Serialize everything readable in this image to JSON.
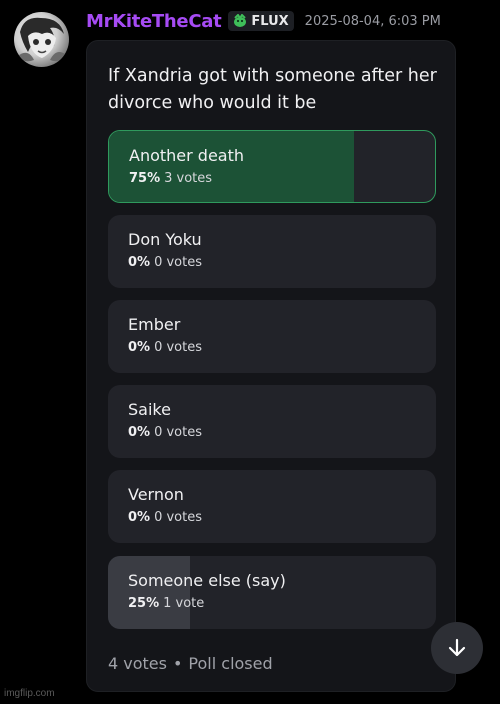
{
  "message": {
    "username": "MrKiteTheCat",
    "tag": {
      "icon": "leaf-icon",
      "label": "FLUX"
    },
    "timestamp": "2025-08-04, 6:03 PM",
    "colors": {
      "username": "#a64bf4",
      "winner_border": "#2f9a5d",
      "winner_fill": "#1c5236"
    }
  },
  "poll": {
    "question": "If Xandria got with someone after her divorce who would it be",
    "options": [
      {
        "label": "Another death",
        "percent": "75%",
        "votes": "3 votes",
        "share": 0.75,
        "winner": true
      },
      {
        "label": "Don Yoku",
        "percent": "0%",
        "votes": "0 votes",
        "share": 0,
        "winner": false
      },
      {
        "label": "Ember",
        "percent": "0%",
        "votes": "0 votes",
        "share": 0,
        "winner": false
      },
      {
        "label": "Saike",
        "percent": "0%",
        "votes": "0 votes",
        "share": 0,
        "winner": false
      },
      {
        "label": "Vernon",
        "percent": "0%",
        "votes": "0 votes",
        "share": 0,
        "winner": false
      },
      {
        "label": "Someone else (say)",
        "percent": "25%",
        "votes": "1 vote",
        "share": 0.25,
        "winner": false
      }
    ],
    "footer": {
      "total": "4 votes",
      "separator": "•",
      "status": "Poll closed"
    }
  },
  "scroll_button": {
    "icon": "arrow-down-icon"
  },
  "watermark": "imgflip.com"
}
